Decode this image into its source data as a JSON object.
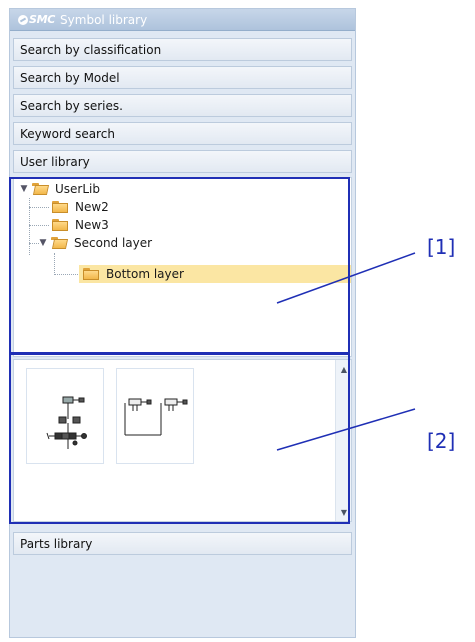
{
  "panel": {
    "logo_text": "SMC",
    "title": "Symbol library"
  },
  "accordion": {
    "items": [
      {
        "label": "Search by classification"
      },
      {
        "label": "Search by Model"
      },
      {
        "label": "Search by series."
      },
      {
        "label": "Keyword search"
      },
      {
        "label": "User library"
      }
    ],
    "bottom": {
      "label": "Parts library"
    }
  },
  "tree": {
    "nodes": [
      {
        "label": "UserLib",
        "expanded": true,
        "level": 0
      },
      {
        "label": "New2",
        "expanded": false,
        "level": 1
      },
      {
        "label": "New3",
        "expanded": false,
        "level": 1
      },
      {
        "label": "Second layer",
        "expanded": true,
        "level": 1
      },
      {
        "label": "Bottom layer",
        "expanded": false,
        "level": 2,
        "selected": true
      }
    ]
  },
  "symbols": {
    "items": [
      {
        "icon": "valve-circuit-symbol-icon"
      },
      {
        "icon": "dual-cylinder-symbol-icon"
      }
    ]
  },
  "annotations": {
    "callout_1": "[1]",
    "callout_2": "[2]",
    "color": "#1f2fb5"
  },
  "colors": {
    "header_bar": "#aec3dc",
    "selected_row": "#fbe6a3",
    "folder": "#f2b84b"
  }
}
